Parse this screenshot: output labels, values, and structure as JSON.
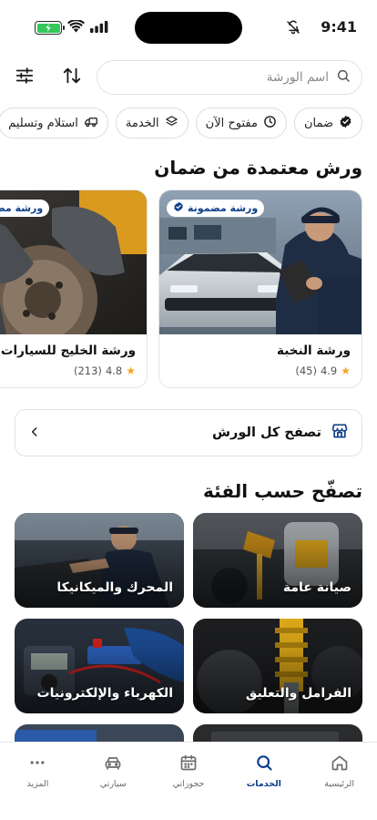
{
  "status_bar": {
    "time": "9:41"
  },
  "search": {
    "placeholder": "اسم الورشة"
  },
  "chips": [
    {
      "label": "ضمان",
      "icon": "verified-icon"
    },
    {
      "label": "مفتوح الآن",
      "icon": "clock-icon"
    },
    {
      "label": "الخدمة",
      "icon": "layers-icon"
    },
    {
      "label": "استلام وتسليم",
      "icon": "truck-icon"
    }
  ],
  "certified": {
    "title": "ورش معتمدة من ضمان",
    "badge_label": "ورشة مضمونة",
    "workshops": [
      {
        "name": "ورشة النخبة",
        "rating": "4.9",
        "reviews": "(45)"
      },
      {
        "name": "ورشة الخليج للسيارات",
        "rating": "4.8",
        "reviews": "(213)"
      }
    ]
  },
  "browse_all": {
    "label": "تصفح كل الورش"
  },
  "categories": {
    "title": "تصفّح حسب الفئة",
    "items": [
      {
        "label": "صيانة عامة"
      },
      {
        "label": "المحرك والميكانيكا"
      },
      {
        "label": "الفرامل والتعليق"
      },
      {
        "label": "الكهرباء والإلكترونيات"
      },
      {
        "label": ""
      },
      {
        "label": ""
      }
    ]
  },
  "bottom_nav": {
    "items": [
      {
        "label": "الرئيسية",
        "icon": "home-icon",
        "active": false
      },
      {
        "label": "الخدمات",
        "icon": "search-icon",
        "active": true
      },
      {
        "label": "حجوزاتي",
        "icon": "calendar-icon",
        "active": false
      },
      {
        "label": "سيارتي",
        "icon": "car-icon",
        "active": false
      },
      {
        "label": "المزيد",
        "icon": "more-icon",
        "active": false
      }
    ]
  },
  "colors": {
    "accent": "#0e3f8c",
    "star": "#f5a623",
    "battery": "#34c759"
  }
}
